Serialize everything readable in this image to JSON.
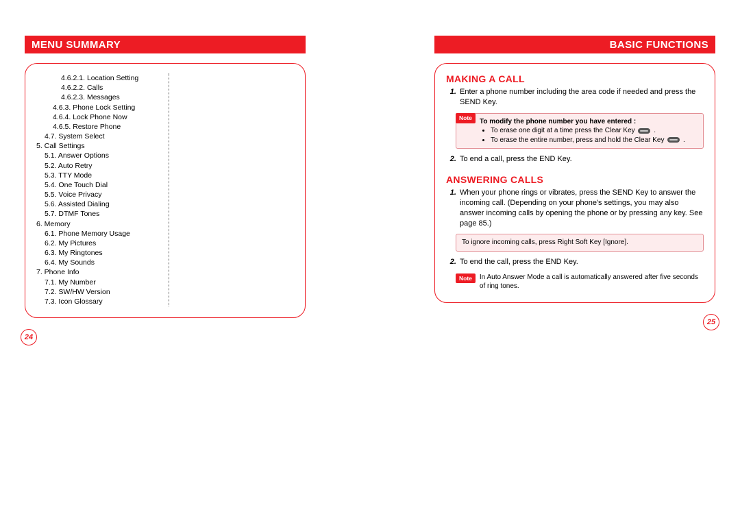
{
  "left": {
    "header": "MENU SUMMARY",
    "page_num": "24",
    "menu": [
      {
        "t": "4.6.2.1. Location Setting",
        "lvl": 4
      },
      {
        "t": "4.6.2.2. Calls",
        "lvl": 4
      },
      {
        "t": "4.6.2.3. Messages",
        "lvl": 4
      },
      {
        "t": "4.6.3. Phone Lock Setting",
        "lvl": 3
      },
      {
        "t": "4.6.4. Lock Phone Now",
        "lvl": 3
      },
      {
        "t": "4.6.5. Restore Phone",
        "lvl": 3
      },
      {
        "t": "4.7. System Select",
        "lvl": 2
      },
      {
        "t": "5. Call Settings",
        "lvl": 1
      },
      {
        "t": "5.1. Answer Options",
        "lvl": 2
      },
      {
        "t": "5.2. Auto Retry",
        "lvl": 2
      },
      {
        "t": "5.3. TTY Mode",
        "lvl": 2
      },
      {
        "t": "5.4. One Touch Dial",
        "lvl": 2
      },
      {
        "t": "5.5. Voice Privacy",
        "lvl": 2
      },
      {
        "t": "5.6. Assisted Dialing",
        "lvl": 2
      },
      {
        "t": "5.7. DTMF Tones",
        "lvl": 2
      },
      {
        "t": "6. Memory",
        "lvl": 1
      },
      {
        "t": "6.1. Phone Memory Usage",
        "lvl": 2
      },
      {
        "t": "6.2. My Pictures",
        "lvl": 2
      },
      {
        "t": "6.3. My Ringtones",
        "lvl": 2
      },
      {
        "t": "6.4. My Sounds",
        "lvl": 2
      },
      {
        "t": "7. Phone Info",
        "lvl": 1
      },
      {
        "t": "7.1. My Number",
        "lvl": 2
      },
      {
        "t": "7.2. SW/HW Version",
        "lvl": 2
      },
      {
        "t": "7.3. Icon Glossary",
        "lvl": 2
      }
    ]
  },
  "right": {
    "header": "BASIC FUNCTIONS",
    "page_num": "25",
    "s1": {
      "title": "MAKING A CALL",
      "step1": "Enter a phone number including the area code if needed and press the SEND Key.",
      "note_label": "Note",
      "note_heading": "To modify the phone number you have entered :",
      "note_b1_a": "To erase one digit at a time press the Clear Key",
      "note_b1_b": ".",
      "note_b2_a": "To erase the entire number, press and hold the Clear Key",
      "note_b2_b": ".",
      "step2": "To end a call, press the END Key."
    },
    "s2": {
      "title": "ANSWERING CALLS",
      "step1": "When your phone rings or vibrates, press the SEND Key to answer the incoming call. (Depending on your phone's settings, you may also answer incoming calls by opening the phone or by pressing any key. See page 85.)",
      "note1": "To ignore incoming calls, press Right Soft Key [Ignore].",
      "step2": "To end the call, press the END Key.",
      "note2_label": "Note",
      "note2": "In Auto Answer Mode a call is automatically answered after five seconds of ring tones."
    }
  }
}
